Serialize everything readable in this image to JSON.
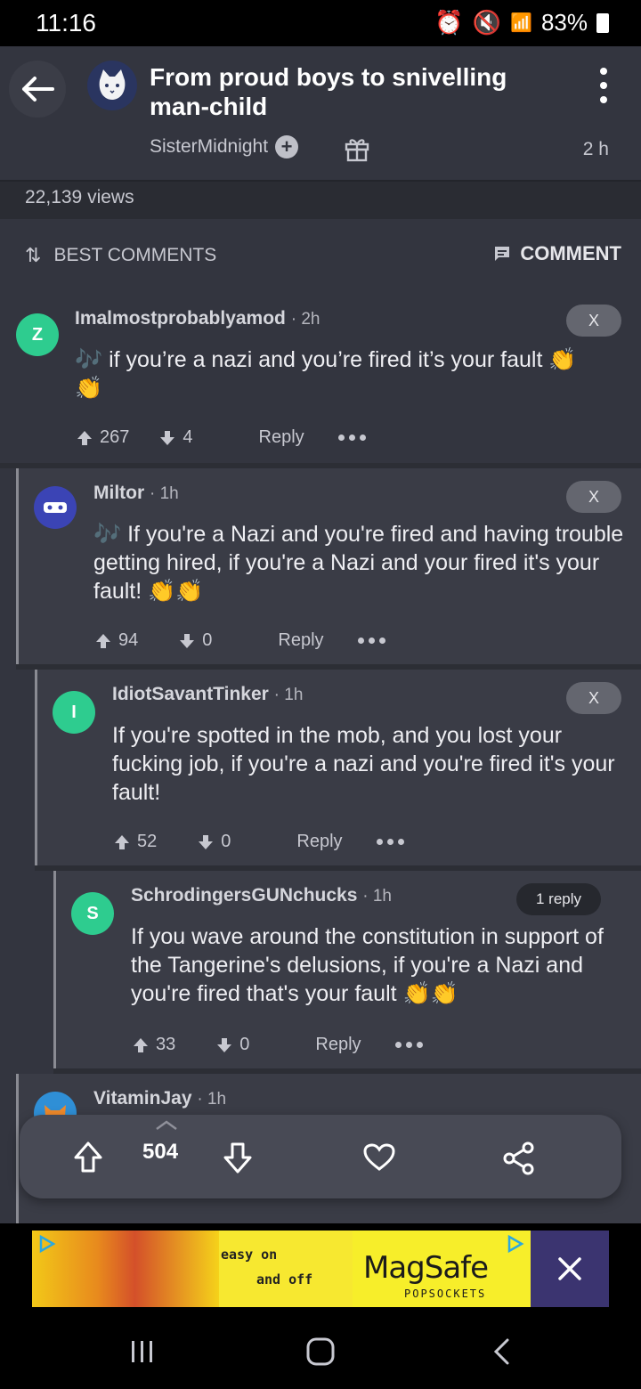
{
  "status_bar": {
    "time": "11:16",
    "battery": "83%"
  },
  "header": {
    "title": "From proud boys to snivelling man-child",
    "author": "SisterMidnight",
    "time_ago": "2 h",
    "views": "22,139 views"
  },
  "comments_header": {
    "sort_label": "BEST COMMENTS",
    "comment_button": "COMMENT"
  },
  "comments": [
    {
      "user": "Imalmostprobablyamod",
      "time": "2h",
      "avatar_letter": "Z",
      "text": "if you’re a nazi and you’re fired it’s your fault",
      "upvotes": "267",
      "downvotes": "4",
      "reply_label": "Reply",
      "badge": "X"
    },
    {
      "user": "Miltor",
      "time": "1h",
      "text": "If you're a Nazi and you're fired and having trouble getting hired, if you're a Nazi and your fired it's your fault!",
      "upvotes": "94",
      "downvotes": "0",
      "reply_label": "Reply",
      "badge": "X"
    },
    {
      "user": "IdiotSavantTinker",
      "time": "1h",
      "avatar_letter": "I",
      "text": "If you're spotted in the mob, and you lost your fucking job, if you're a nazi and you're fired it's your fault!",
      "upvotes": "52",
      "downvotes": "0",
      "reply_label": "Reply",
      "badge": "X"
    },
    {
      "user": "SchrodingersGUNchucks",
      "time": "1h",
      "avatar_letter": "S",
      "text": "If you wave around the constitution in support of the Tangerine's delusions, if you're a Nazi and you're fired that's your fault",
      "upvotes": "33",
      "downvotes": "0",
      "reply_label": "Reply",
      "badge": "1 reply"
    },
    {
      "user": "VitaminJay",
      "time": "1h"
    }
  ],
  "vote_bar": {
    "score": "504"
  },
  "ad": {
    "line1": "easy on",
    "line2": "and off",
    "brand": "MagSafe",
    "sub": "POPSOCKETS"
  },
  "colors": {
    "background": "#33353f",
    "comment_bg": "#3a3c46",
    "green_avatar": "#2ecc8f"
  }
}
